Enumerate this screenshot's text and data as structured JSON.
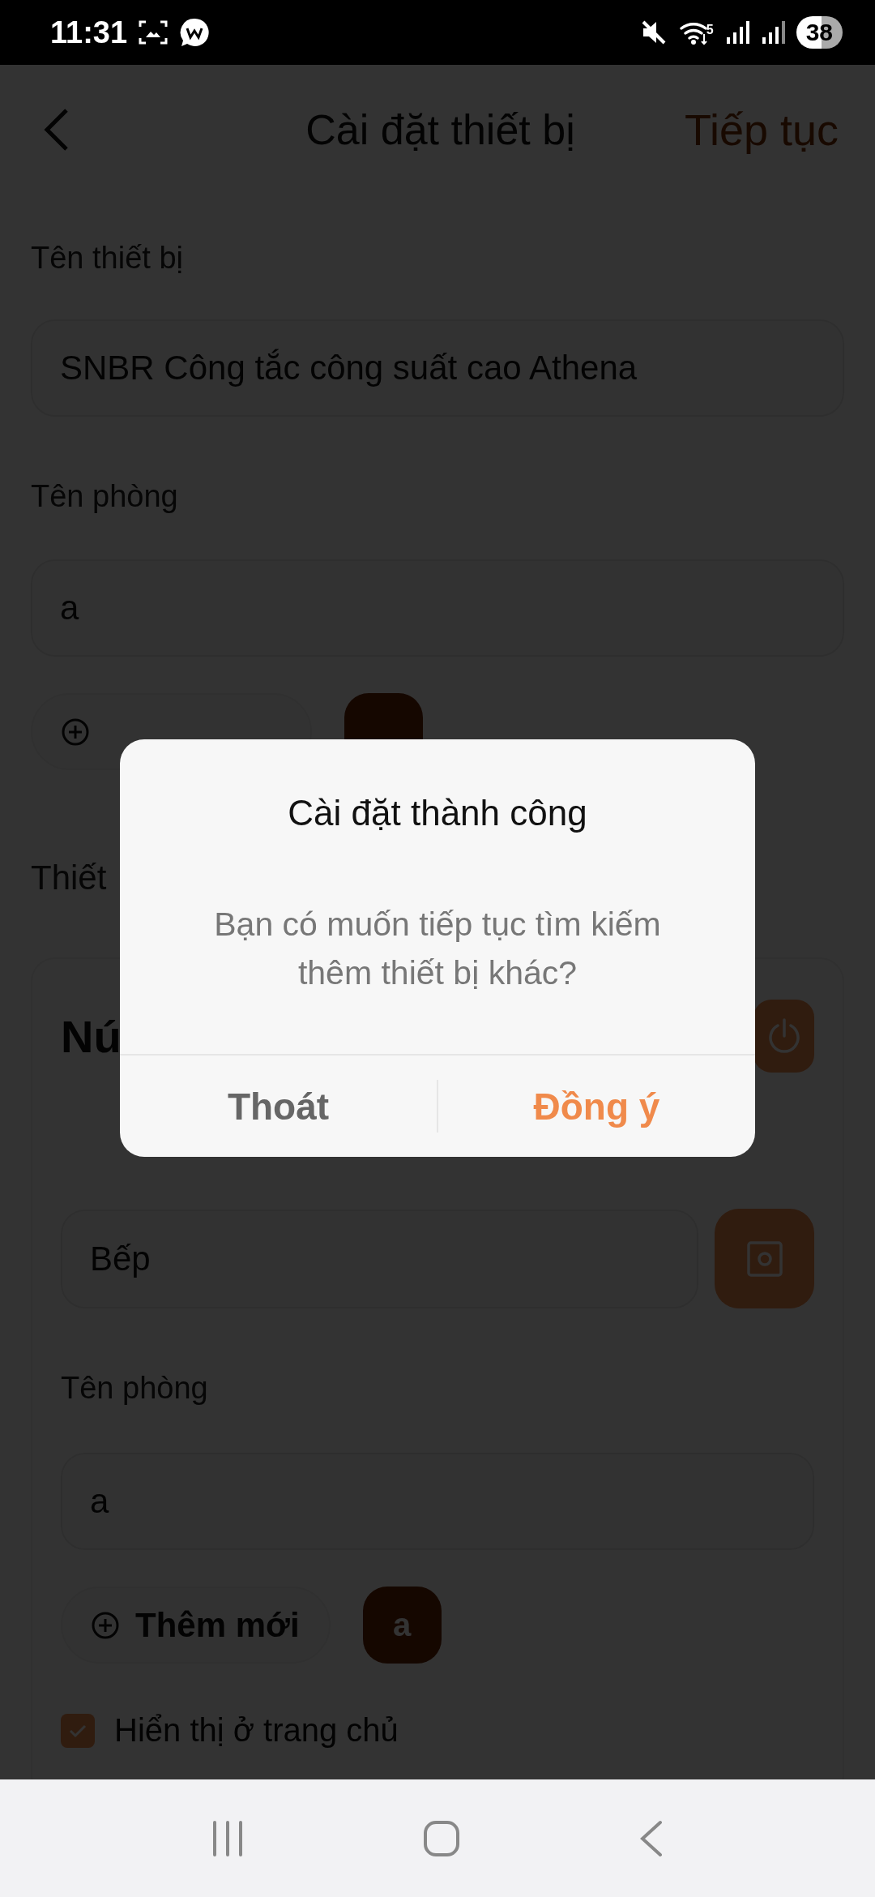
{
  "status_bar": {
    "time": "11:31",
    "network_label": "5",
    "battery": "38"
  },
  "header": {
    "title": "Cài đặt thiết bị",
    "action": "Tiếp tục"
  },
  "form": {
    "device_name": {
      "label": "Tên thiết bị",
      "value": "SNBR Công tắc công suất cao Athena"
    },
    "room": {
      "label": "Tên phòng",
      "value": "a"
    },
    "room_chips": [
      {
        "selected": true
      }
    ],
    "section_label": "Thiết"
  },
  "card": {
    "title": "Nú",
    "controlled_value": "Bếp",
    "room": {
      "label": "Tên phòng",
      "value": "a"
    },
    "add_button": "Thêm mới",
    "room_chips": [
      {
        "label": "a",
        "selected": true
      }
    ],
    "show_on_home": {
      "label": "Hiển thị ở trang chủ",
      "checked": true
    }
  },
  "dialog": {
    "title": "Cài đặt thành công",
    "message": "Bạn có muốn tiếp tục tìm kiếm thêm thiết bị khác?",
    "buttons": [
      {
        "label": "Thoát",
        "kind": "cancel"
      },
      {
        "label": "Đồng ý",
        "kind": "confirm"
      }
    ]
  }
}
